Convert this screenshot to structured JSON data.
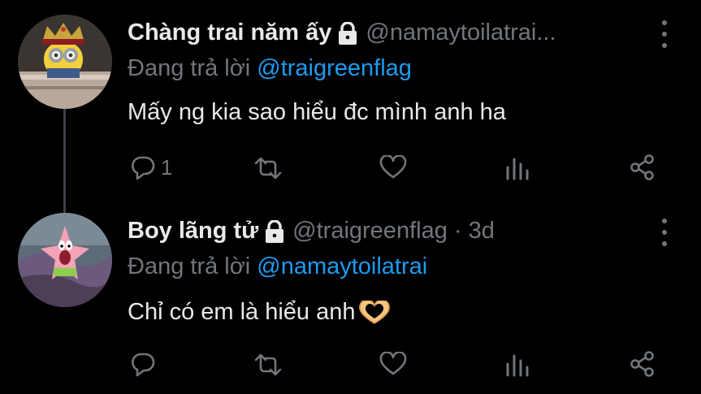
{
  "tweets": [
    {
      "display_name": "Chàng trai năm ấy",
      "handle": "@namaytoilatrai...",
      "reply_prefix": "Đang trả lời ",
      "reply_to": "@traigreenflag",
      "text": "Mấy ng kia sao hiểu đc mình anh ha",
      "reply_count": "1",
      "avatar": "minion-king-avatar"
    },
    {
      "display_name": "Boy lãng tử",
      "handle": "@traigreenflag · 3d",
      "reply_prefix": "Đang trả lời ",
      "reply_to": "@namaytoilatrai",
      "text": "Chỉ có em là hiểu anh",
      "emoji": "heart-hands-emoji",
      "reply_count": "",
      "avatar": "patrick-star-avatar"
    }
  ],
  "colors": {
    "background": "#000000",
    "text": "#e7e9ea",
    "secondary": "#71767b",
    "accent": "#1d9bf0",
    "thread_line": "#3d4148"
  },
  "icons": [
    "reply-icon",
    "retweet-icon",
    "like-icon",
    "views-icon",
    "share-icon",
    "lock-icon",
    "more-icon"
  ]
}
